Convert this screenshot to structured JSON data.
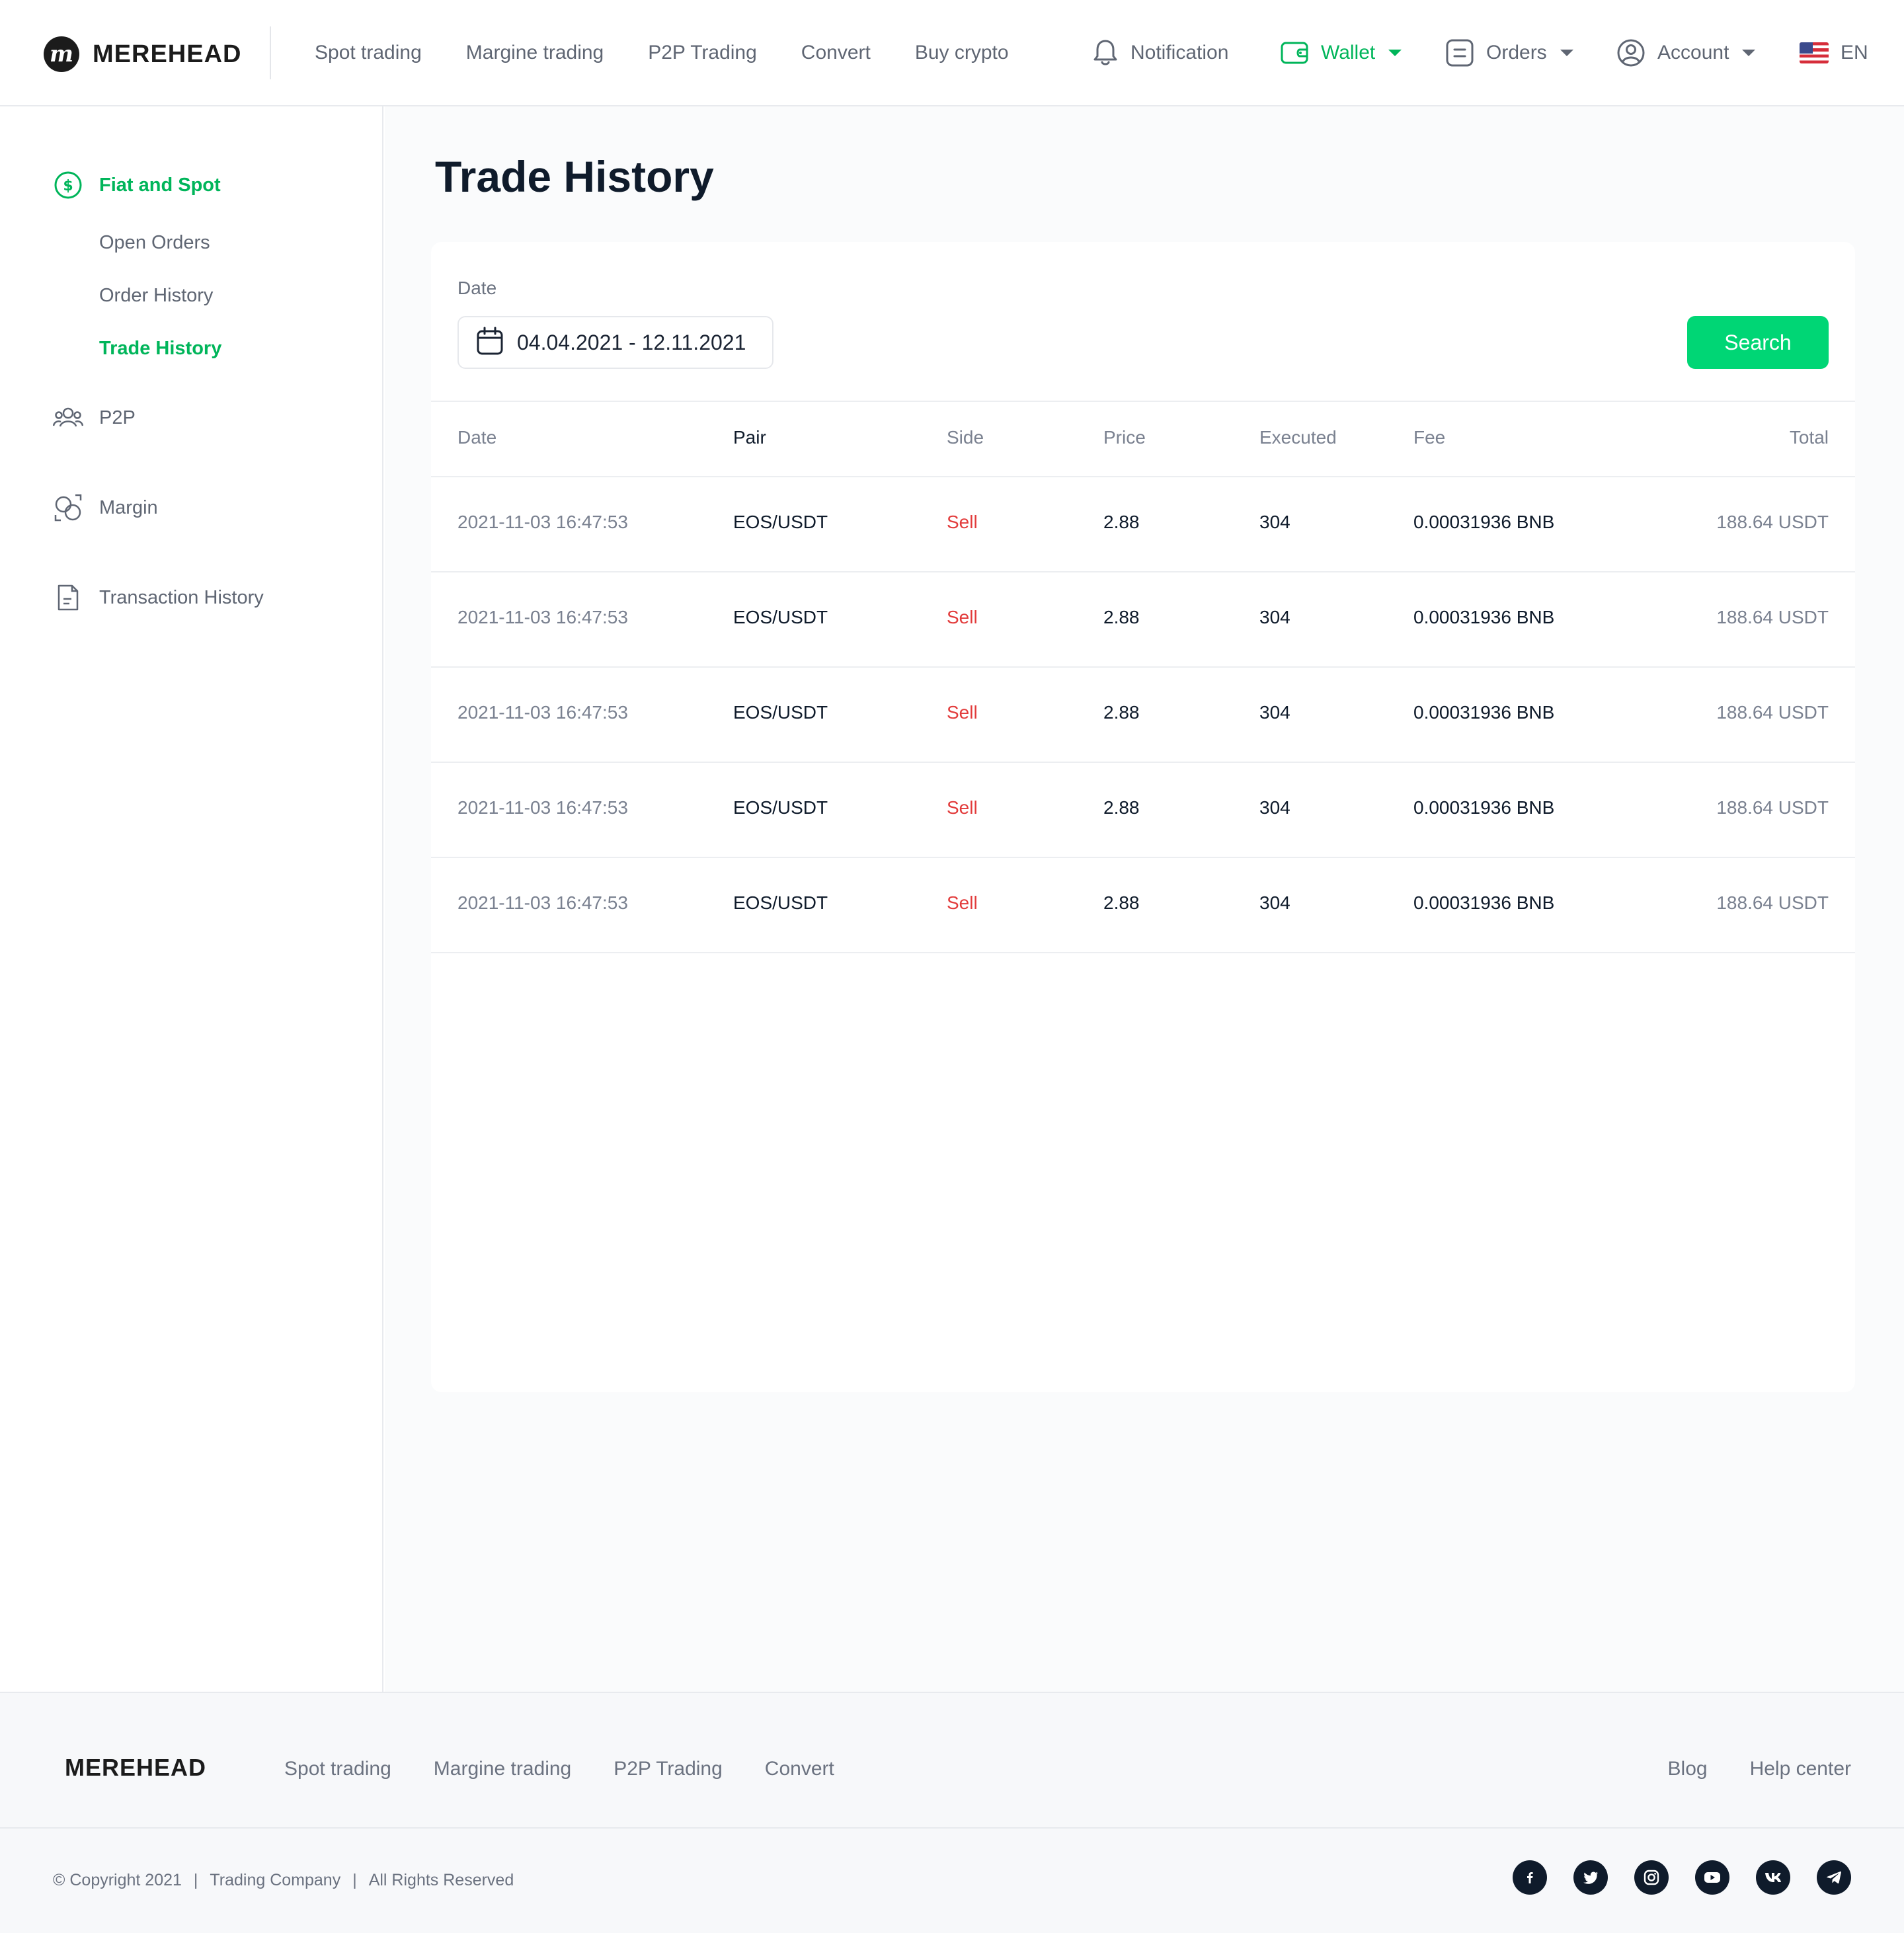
{
  "brand": {
    "name": "MEREHEAD",
    "footer_name": "MEREHEAD"
  },
  "nav": {
    "items": [
      "Spot trading",
      "Margine trading",
      "P2P Trading",
      "Convert",
      "Buy crypto"
    ]
  },
  "header": {
    "notification": "Notification",
    "wallet": "Wallet",
    "orders": "Orders",
    "account": "Account",
    "language": "EN"
  },
  "sidebar": {
    "fiat_spot": "Fiat and Spot",
    "sub": [
      "Open Orders",
      "Order History",
      "Trade History"
    ],
    "p2p": "P2P",
    "margin": "Margin",
    "transaction_history": "Transaction History"
  },
  "page": {
    "title": "Trade History",
    "date_label": "Date",
    "date_range": "04.04.2021 - 12.11.2021",
    "search_button": "Search"
  },
  "table": {
    "columns": [
      "Date",
      "Pair",
      "Side",
      "Price",
      "Executed",
      "Fee",
      "Total"
    ],
    "rows": [
      [
        "2021-11-03 16:47:53",
        "EOS/USDT",
        "Sell",
        "2.88",
        "304",
        "0.00031936 BNB",
        "188.64 USDT"
      ],
      [
        "2021-11-03 16:47:53",
        "EOS/USDT",
        "Sell",
        "2.88",
        "304",
        "0.00031936 BNB",
        "188.64 USDT"
      ],
      [
        "2021-11-03 16:47:53",
        "EOS/USDT",
        "Sell",
        "2.88",
        "304",
        "0.00031936 BNB",
        "188.64 USDT"
      ],
      [
        "2021-11-03 16:47:53",
        "EOS/USDT",
        "Sell",
        "2.88",
        "304",
        "0.00031936 BNB",
        "188.64 USDT"
      ],
      [
        "2021-11-03 16:47:53",
        "EOS/USDT",
        "Sell",
        "2.88",
        "304",
        "0.00031936 BNB",
        "188.64 USDT"
      ]
    ]
  },
  "footer": {
    "nav": [
      "Spot trading",
      "Margine trading",
      "P2P Trading",
      "Convert"
    ],
    "right": [
      "Blog",
      "Help center"
    ],
    "copyright": "© Copyright 2021",
    "company": "Trading Company",
    "rights": "All Rights Reserved",
    "socials": [
      "facebook-icon",
      "twitter-icon",
      "instagram-icon",
      "youtube-icon",
      "vk-icon",
      "telegram-icon"
    ]
  },
  "colors": {
    "accent": "#00b55a",
    "button": "#00d675",
    "sell": "#e23b3b",
    "title": "#0f1b2b"
  }
}
